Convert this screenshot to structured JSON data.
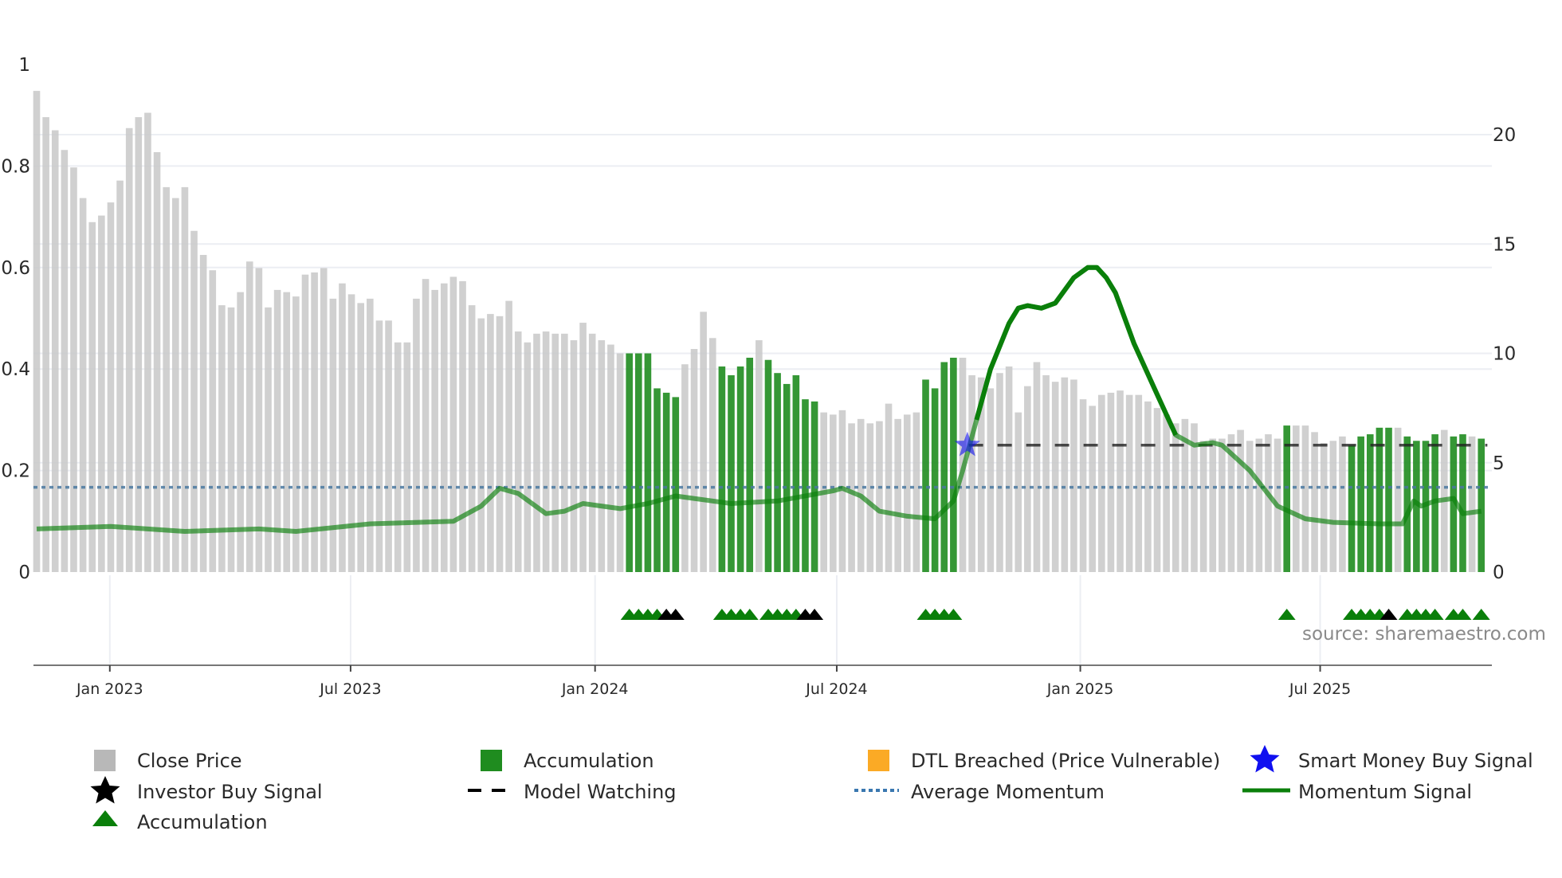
{
  "chart_data": {
    "type": "bar",
    "title": "",
    "source": "source: sharemaestro.com",
    "x_unit": "weekly bar index",
    "x_ticks": [
      {
        "label": "Jan 2023",
        "at": 7.9
      },
      {
        "label": "Jul 2023",
        "at": 33.9
      },
      {
        "label": "Jan 2024",
        "at": 60.3
      },
      {
        "label": "Jul 2024",
        "at": 86.4
      },
      {
        "label": "Jan 2025",
        "at": 112.7
      },
      {
        "label": "Jul 2025",
        "at": 138.6
      }
    ],
    "left_axis": {
      "ylim": [
        0,
        1
      ],
      "ticks": [
        "0",
        "0.2",
        "0.4",
        "0.6",
        "0.8",
        "1"
      ],
      "tick_values": [
        0,
        0.2,
        0.4,
        0.6,
        0.8,
        1
      ]
    },
    "right_axis": {
      "ylim": [
        0,
        23.2
      ],
      "ticks": [
        "0",
        "5",
        "10",
        "15",
        "20"
      ],
      "tick_values": [
        0,
        5,
        10,
        15,
        20
      ]
    },
    "close_price": [
      22.0,
      20.8,
      20.2,
      19.3,
      18.5,
      17.1,
      16.0,
      16.3,
      16.9,
      17.9,
      20.3,
      20.8,
      21.0,
      19.2,
      17.6,
      17.1,
      17.6,
      15.6,
      14.5,
      13.8,
      12.2,
      12.1,
      12.8,
      14.2,
      13.9,
      12.1,
      12.9,
      12.8,
      12.6,
      13.6,
      13.7,
      13.9,
      12.5,
      13.2,
      12.7,
      12.3,
      12.5,
      11.5,
      11.5,
      10.5,
      10.5,
      12.5,
      13.4,
      12.9,
      13.2,
      13.5,
      13.3,
      12.2,
      11.6,
      11.8,
      11.7,
      12.4,
      11.0,
      10.5,
      10.9,
      11.0,
      10.9,
      10.9,
      10.6,
      11.4,
      10.9,
      10.6,
      10.4,
      10.0,
      10.0,
      10.0,
      10.0,
      8.4,
      8.2,
      8.0,
      9.5,
      10.2,
      11.9,
      10.7,
      9.4,
      9.0,
      9.4,
      9.8,
      10.6,
      9.7,
      9.1,
      8.6,
      9.0,
      7.9,
      7.8,
      7.3,
      7.2,
      7.4,
      6.8,
      7.0,
      6.8,
      6.9,
      7.7,
      7.0,
      7.2,
      7.3,
      8.8,
      8.4,
      9.6,
      9.8,
      9.8,
      9.0,
      8.9,
      8.4,
      9.1,
      9.4,
      7.3,
      8.5,
      9.6,
      9.0,
      8.7,
      8.9,
      8.8,
      7.9,
      7.6,
      8.1,
      8.2,
      8.3,
      8.1,
      8.1,
      7.8,
      7.5,
      7.2,
      6.8,
      7.0,
      6.8,
      6.0,
      6.1,
      6.1,
      6.3,
      6.5,
      6.0,
      6.1,
      6.3,
      6.1,
      6.7,
      6.7,
      6.7,
      6.4,
      5.9,
      6.0,
      6.2,
      5.8,
      6.2,
      6.3,
      6.6,
      6.6,
      6.6,
      6.2,
      6.0,
      6.0,
      6.3,
      6.5,
      6.2,
      6.3,
      6.2,
      6.1
    ],
    "accumulation_indices": [
      64,
      65,
      66,
      67,
      68,
      69,
      74,
      75,
      76,
      77,
      79,
      80,
      81,
      82,
      83,
      84,
      96,
      97,
      98,
      99,
      135,
      142,
      143,
      144,
      145,
      146,
      148,
      149,
      150,
      151,
      153,
      154,
      156
    ],
    "investor_buy_indices": [
      68,
      69,
      83,
      84,
      146
    ],
    "smart_money_buy": {
      "index": 100.5,
      "value": 0.25
    },
    "model_watching": {
      "from": 101,
      "to": 157,
      "price": 5.8
    },
    "average_momentum": 0.167,
    "momentum_signal": [
      [
        0,
        0.085
      ],
      [
        8,
        0.09
      ],
      [
        16,
        0.08
      ],
      [
        24,
        0.085
      ],
      [
        28,
        0.08
      ],
      [
        36,
        0.095
      ],
      [
        45,
        0.1
      ],
      [
        48,
        0.13
      ],
      [
        50,
        0.165
      ],
      [
        52,
        0.155
      ],
      [
        55,
        0.115
      ],
      [
        57,
        0.12
      ],
      [
        59,
        0.135
      ],
      [
        63,
        0.125
      ],
      [
        66,
        0.135
      ],
      [
        69,
        0.15
      ],
      [
        75,
        0.135
      ],
      [
        80,
        0.14
      ],
      [
        86,
        0.16
      ],
      [
        87,
        0.165
      ],
      [
        89,
        0.15
      ],
      [
        91,
        0.12
      ],
      [
        94,
        0.11
      ],
      [
        97,
        0.105
      ],
      [
        99,
        0.14
      ],
      [
        100,
        0.2
      ],
      [
        101.5,
        0.3
      ],
      [
        103,
        0.4
      ],
      [
        105,
        0.49
      ],
      [
        106,
        0.52
      ],
      [
        107,
        0.525
      ],
      [
        108.5,
        0.52
      ],
      [
        110,
        0.53
      ],
      [
        112,
        0.58
      ],
      [
        113.5,
        0.6
      ],
      [
        114.5,
        0.6
      ],
      [
        115.5,
        0.58
      ],
      [
        116.5,
        0.55
      ],
      [
        118.5,
        0.45
      ],
      [
        121,
        0.35
      ],
      [
        123,
        0.27
      ],
      [
        125,
        0.25
      ],
      [
        127,
        0.255
      ],
      [
        128,
        0.25
      ],
      [
        131,
        0.2
      ],
      [
        134,
        0.13
      ],
      [
        137,
        0.105
      ],
      [
        140,
        0.098
      ],
      [
        145,
        0.095
      ],
      [
        147.5,
        0.095
      ],
      [
        148.7,
        0.14
      ],
      [
        149.5,
        0.13
      ],
      [
        151,
        0.14
      ],
      [
        153,
        0.145
      ],
      [
        154,
        0.115
      ],
      [
        156,
        0.12
      ]
    ],
    "momentum_strong_range": [
      100.5,
      123.5
    ],
    "legend": {
      "close_price": "Close Price",
      "accumulation_bar": "Accumulation",
      "dtl_breached": "DTL Breached (Price Vulnerable)",
      "smart_money": "Smart Money Buy Signal",
      "investor_buy": "Investor Buy Signal",
      "model_watching": "Model Watching",
      "average_momentum": "Average Momentum",
      "momentum_signal": "Momentum Signal",
      "accumulation_marker": "Accumulation"
    },
    "colors": {
      "close": "#c8c8c8",
      "accum": "#1f8c1f",
      "dtl": "#fbaa25",
      "smart": "#1010f0",
      "investor": "#000000",
      "avg": "#4a78a0",
      "momentum": "#0a7f0a",
      "grid": "#eceef3"
    }
  }
}
